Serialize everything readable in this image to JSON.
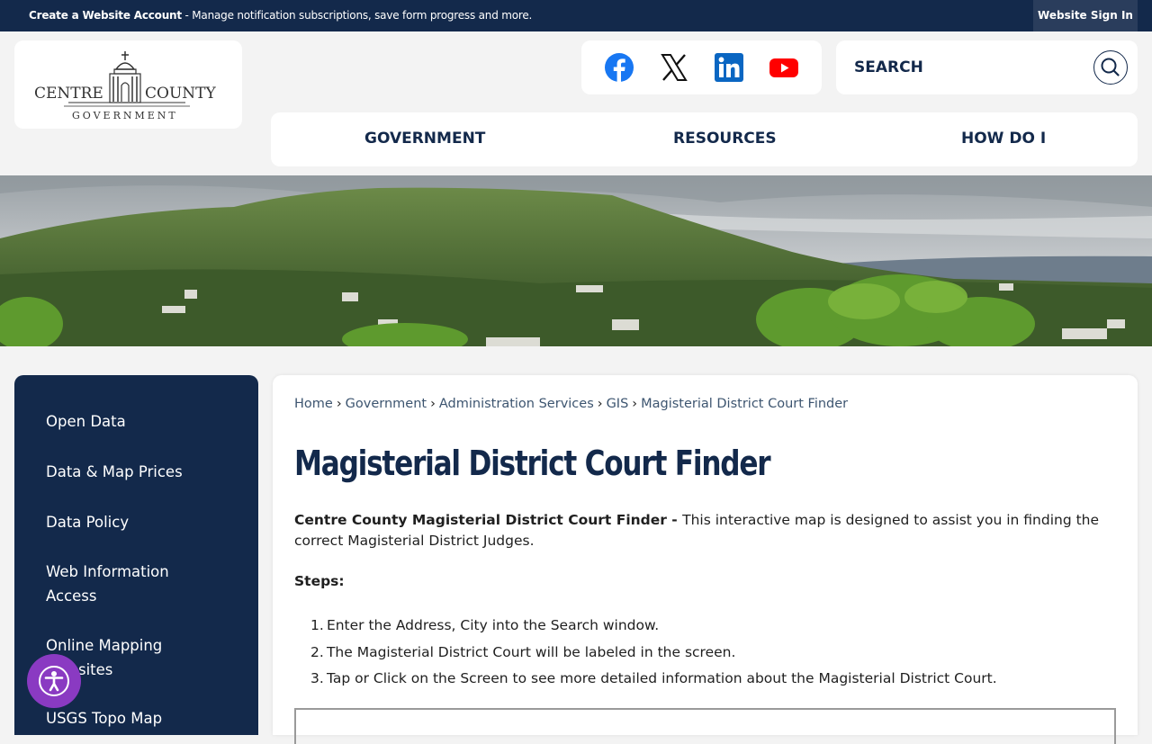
{
  "topbar": {
    "create_account": "Create a Website Account",
    "message": " - Manage notification subscriptions, save form progress and more.",
    "sign_in": "Website Sign In"
  },
  "logo": {
    "line1_left": "CENTRE",
    "line1_right": "COUNTY",
    "line2": "GOVERNMENT"
  },
  "social": {
    "facebook": "facebook-icon",
    "x": "x-icon",
    "linkedin": "linkedin-icon",
    "youtube": "youtube-icon"
  },
  "search": {
    "placeholder": "SEARCH"
  },
  "nav": {
    "items": [
      "GOVERNMENT",
      "RESOURCES",
      "HOW DO I"
    ]
  },
  "sidebar": {
    "items": [
      "Open Data",
      "Data & Map Prices",
      "Data Policy",
      "Web Information Access",
      "Online Mapping Websites",
      "USGS Topo Map"
    ]
  },
  "breadcrumb": [
    "Home",
    "Government",
    "Administration Services",
    "GIS",
    "Magisterial District Court Finder"
  ],
  "page": {
    "title": "Magisterial District Court Finder",
    "intro_bold": "Centre County Magisterial District Court Finder - ",
    "intro_text": "This interactive map is designed to assist you in finding the correct Magisterial District Judges.",
    "steps_heading": "Steps:",
    "steps": [
      "Enter the Address, City into the Search window.",
      "The Magisterial District Court will be labeled in the screen.",
      "Tap or Click on the Screen to see more detailed information about the Magisterial District Court."
    ]
  },
  "colors": {
    "navy": "#13294b",
    "accessibility": "#8a3ac2"
  }
}
